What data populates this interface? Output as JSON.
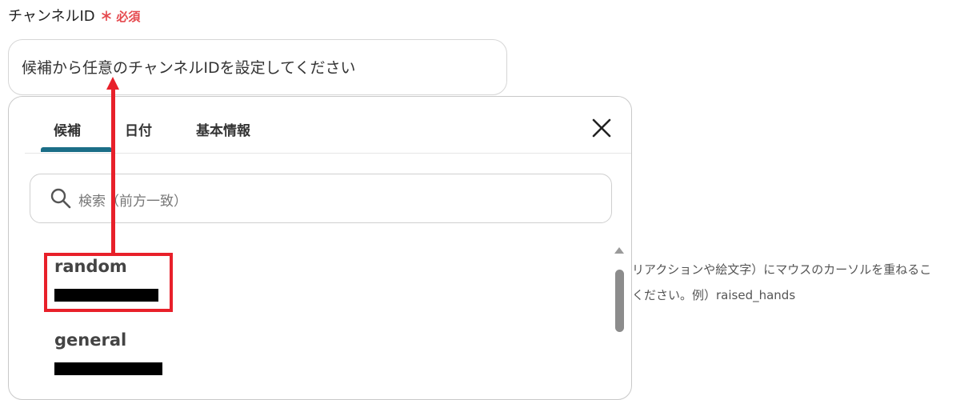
{
  "field": {
    "label": "チャンネルID",
    "required_label": "必須",
    "placeholder_text": "候補から任意のチャンネルIDを設定してください"
  },
  "background_hint": {
    "line1": "リアクションや絵文字）にマウスのカーソルを重ねるこ",
    "line2": "ください。例）raised_hands"
  },
  "popover": {
    "tabs": [
      {
        "label": "候補",
        "active": true
      },
      {
        "label": "日付",
        "active": false
      },
      {
        "label": "基本情報",
        "active": false
      }
    ],
    "search_placeholder": "検索（前方一致）",
    "items": [
      {
        "name": "random",
        "id_redacted": true
      },
      {
        "name": "general",
        "id_redacted": true
      }
    ]
  },
  "colors": {
    "required": "#e5484d",
    "tab_active": "#1b6e87",
    "annotation": "#e8202a"
  }
}
